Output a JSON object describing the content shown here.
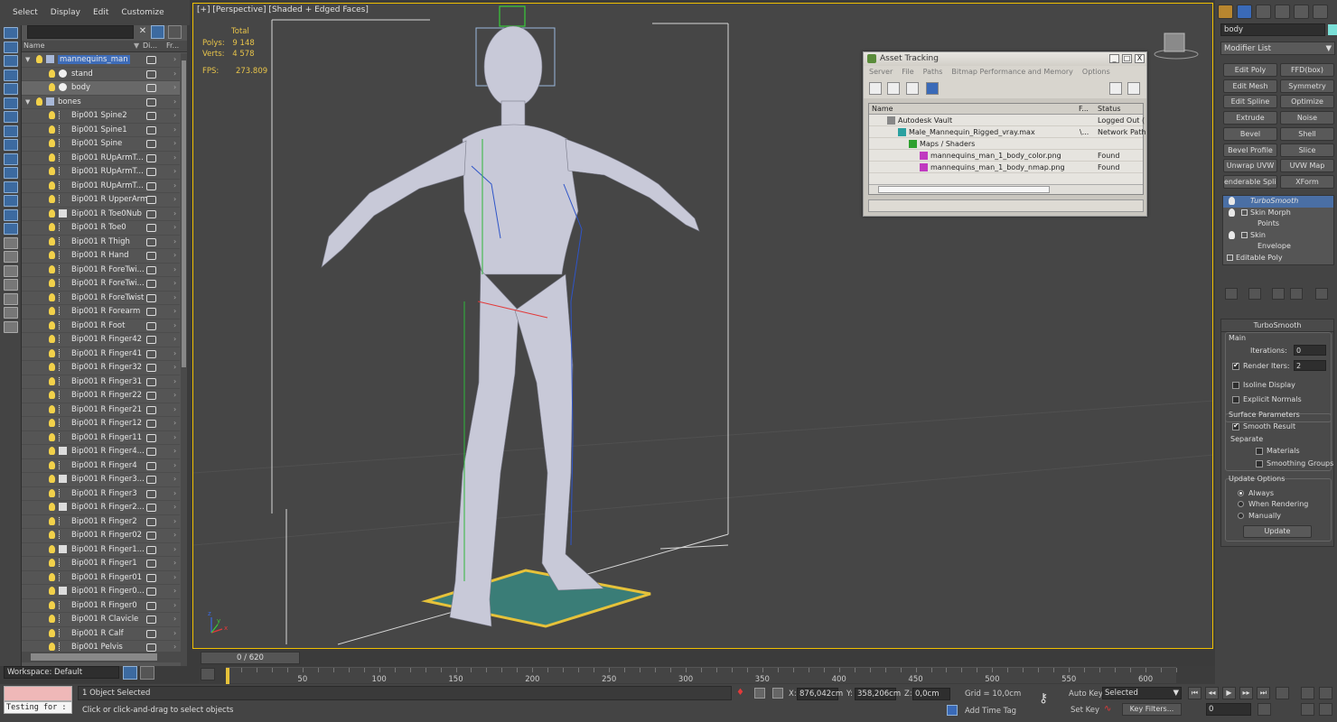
{
  "menu": {
    "items": [
      "Select",
      "Display",
      "Edit",
      "Customize"
    ]
  },
  "explorer": {
    "columns": [
      "Name",
      "Di...",
      "Fr..."
    ],
    "rows": [
      {
        "label": "mannequins_man",
        "level": 1,
        "type": "layer",
        "selected": true
      },
      {
        "label": "stand",
        "level": 2,
        "type": "object"
      },
      {
        "label": "body",
        "level": 2,
        "type": "object",
        "highlight": true
      },
      {
        "label": "bones",
        "level": 1,
        "type": "layer"
      },
      {
        "label": "Bip001 Spine2",
        "level": 2,
        "type": "bone"
      },
      {
        "label": "Bip001 Spine1",
        "level": 2,
        "type": "bone"
      },
      {
        "label": "Bip001 Spine",
        "level": 2,
        "type": "bone"
      },
      {
        "label": "Bip001 RUpArmT...",
        "level": 2,
        "type": "bone"
      },
      {
        "label": "Bip001 RUpArmT...",
        "level": 2,
        "type": "bone"
      },
      {
        "label": "Bip001 RUpArmT...",
        "level": 2,
        "type": "bone"
      },
      {
        "label": "Bip001 R UpperArm",
        "level": 2,
        "type": "bone"
      },
      {
        "label": "Bip001 R Toe0Nub",
        "level": 2,
        "type": "box"
      },
      {
        "label": "Bip001 R Toe0",
        "level": 2,
        "type": "bone"
      },
      {
        "label": "Bip001 R Thigh",
        "level": 2,
        "type": "bone"
      },
      {
        "label": "Bip001 R Hand",
        "level": 2,
        "type": "bone"
      },
      {
        "label": "Bip001 R ForeTwi...",
        "level": 2,
        "type": "bone"
      },
      {
        "label": "Bip001 R ForeTwi...",
        "level": 2,
        "type": "bone"
      },
      {
        "label": "Bip001 R ForeTwist",
        "level": 2,
        "type": "bone"
      },
      {
        "label": "Bip001 R Forearm",
        "level": 2,
        "type": "bone"
      },
      {
        "label": "Bip001 R Foot",
        "level": 2,
        "type": "bone"
      },
      {
        "label": "Bip001 R Finger42",
        "level": 2,
        "type": "bone"
      },
      {
        "label": "Bip001 R Finger41",
        "level": 2,
        "type": "bone"
      },
      {
        "label": "Bip001 R Finger32",
        "level": 2,
        "type": "bone"
      },
      {
        "label": "Bip001 R Finger31",
        "level": 2,
        "type": "bone"
      },
      {
        "label": "Bip001 R Finger22",
        "level": 2,
        "type": "bone"
      },
      {
        "label": "Bip001 R Finger21",
        "level": 2,
        "type": "bone"
      },
      {
        "label": "Bip001 R Finger12",
        "level": 2,
        "type": "bone"
      },
      {
        "label": "Bip001 R Finger11",
        "level": 2,
        "type": "bone"
      },
      {
        "label": "Bip001 R Finger4...",
        "level": 2,
        "type": "box"
      },
      {
        "label": "Bip001 R Finger4",
        "level": 2,
        "type": "bone"
      },
      {
        "label": "Bip001 R Finger3...",
        "level": 2,
        "type": "box"
      },
      {
        "label": "Bip001 R Finger3",
        "level": 2,
        "type": "bone"
      },
      {
        "label": "Bip001 R Finger2...",
        "level": 2,
        "type": "box"
      },
      {
        "label": "Bip001 R Finger2",
        "level": 2,
        "type": "bone"
      },
      {
        "label": "Bip001 R Finger02",
        "level": 2,
        "type": "bone"
      },
      {
        "label": "Bip001 R Finger1...",
        "level": 2,
        "type": "box"
      },
      {
        "label": "Bip001 R Finger1",
        "level": 2,
        "type": "bone"
      },
      {
        "label": "Bip001 R Finger01",
        "level": 2,
        "type": "bone"
      },
      {
        "label": "Bip001 R Finger0...",
        "level": 2,
        "type": "box"
      },
      {
        "label": "Bip001 R Finger0",
        "level": 2,
        "type": "bone"
      },
      {
        "label": "Bip001 R Clavicle",
        "level": 2,
        "type": "bone"
      },
      {
        "label": "Bip001 R Calf",
        "level": 2,
        "type": "bone"
      },
      {
        "label": "Bip001 Pelvis",
        "level": 2,
        "type": "bone"
      }
    ]
  },
  "workspace": "Workspace: Default",
  "viewport": {
    "label": "[+] [Perspective] [Shaded + Edged Faces]",
    "stats": {
      "total_label": "Total",
      "polys_label": "Polys:",
      "polys": "9 148",
      "verts_label": "Verts:",
      "verts": "4 578",
      "fps_label": "FPS:",
      "fps": "273.809"
    },
    "axis": {
      "x": "x",
      "y": "y",
      "z": "z"
    }
  },
  "asset_tracking": {
    "title": "Asset Tracking",
    "menu": [
      "Server",
      "File",
      "Paths",
      "Bitmap Performance and Memory",
      "Options"
    ],
    "columns": [
      "Name",
      "F...",
      "Status"
    ],
    "rows": [
      {
        "name": "Autodesk Vault",
        "f": "",
        "status": "Logged Out (",
        "indent": 1,
        "icon": "vault"
      },
      {
        "name": "Male_Mannequin_Rigged_vray.max",
        "f": "\\...",
        "status": "Network Path",
        "indent": 2,
        "icon": "max"
      },
      {
        "name": "Maps / Shaders",
        "f": "",
        "status": "",
        "indent": 3,
        "icon": "maps"
      },
      {
        "name": "mannequins_man_1_body_color.png",
        "f": "",
        "status": "Found",
        "indent": 4,
        "icon": "png"
      },
      {
        "name": "mannequins_man_1_body_nmap.png",
        "f": "",
        "status": "Found",
        "indent": 4,
        "icon": "png"
      }
    ],
    "win_buttons": [
      "_",
      "□",
      "X"
    ]
  },
  "command_panel": {
    "name": "body",
    "modifier_list": "Modifier List",
    "buttons": [
      "Edit Poly",
      "FFD(box)",
      "Edit Mesh",
      "Symmetry",
      "Edit Spline",
      "Optimize",
      "Extrude",
      "Noise",
      "Bevel",
      "Shell",
      "Bevel Profile",
      "Slice",
      "Unwrap UVW",
      "UVW Map",
      "enderable Splin",
      "XForm"
    ],
    "stack": [
      {
        "label": "TurboSmooth",
        "level": 0,
        "selected": true,
        "bulb": true
      },
      {
        "label": "Skin Morph",
        "level": 0,
        "bulb": true,
        "box": true
      },
      {
        "label": "Points",
        "level": 1
      },
      {
        "label": "Skin",
        "level": 0,
        "bulb": true,
        "box": true
      },
      {
        "label": "Envelope",
        "level": 1
      },
      {
        "label": "Editable Poly",
        "level": 0,
        "box": true
      }
    ],
    "turbosmooth": {
      "title": "TurboSmooth",
      "main": "Main",
      "iterations_label": "Iterations:",
      "iterations": "0",
      "render_iters_label": "Render Iters:",
      "render_iters": "2",
      "isoline": "Isoline Display",
      "explicit_normals": "Explicit Normals",
      "surface_params": "Surface Parameters",
      "smooth_result": "Smooth Result",
      "separate": "Separate",
      "materials": "Materials",
      "smoothing_groups": "Smoothing Groups",
      "update_options": "Update Options",
      "always": "Always",
      "when_rendering": "When Rendering",
      "manually": "Manually",
      "update_button": "Update"
    }
  },
  "timeline": {
    "slider": "0 / 620",
    "ticks": [
      50,
      100,
      150,
      200,
      250,
      300,
      350,
      400,
      450,
      500,
      550,
      600
    ],
    "start": 0,
    "end": 620
  },
  "status": {
    "testing": "Testing for :",
    "selected": "1 Object Selected",
    "hint": "Click or click-and-drag to select objects",
    "x_label": "X:",
    "x": "876,042cm",
    "y_label": "Y:",
    "y": "358,206cm",
    "z_label": "Z:",
    "z": "0,0cm",
    "grid": "Grid = 10,0cm",
    "add_time_tag": "Add Time Tag",
    "auto_key": "Auto Key",
    "selected_dropdown": "Selected",
    "set_key": "Set Key",
    "key_filters": "Key Filters...",
    "frame": "0"
  },
  "colors": {
    "accent": "#3e6cb8",
    "viewport_border": "#f0c000",
    "bulb": "#f2d14a",
    "stats": "#e8c44a"
  }
}
